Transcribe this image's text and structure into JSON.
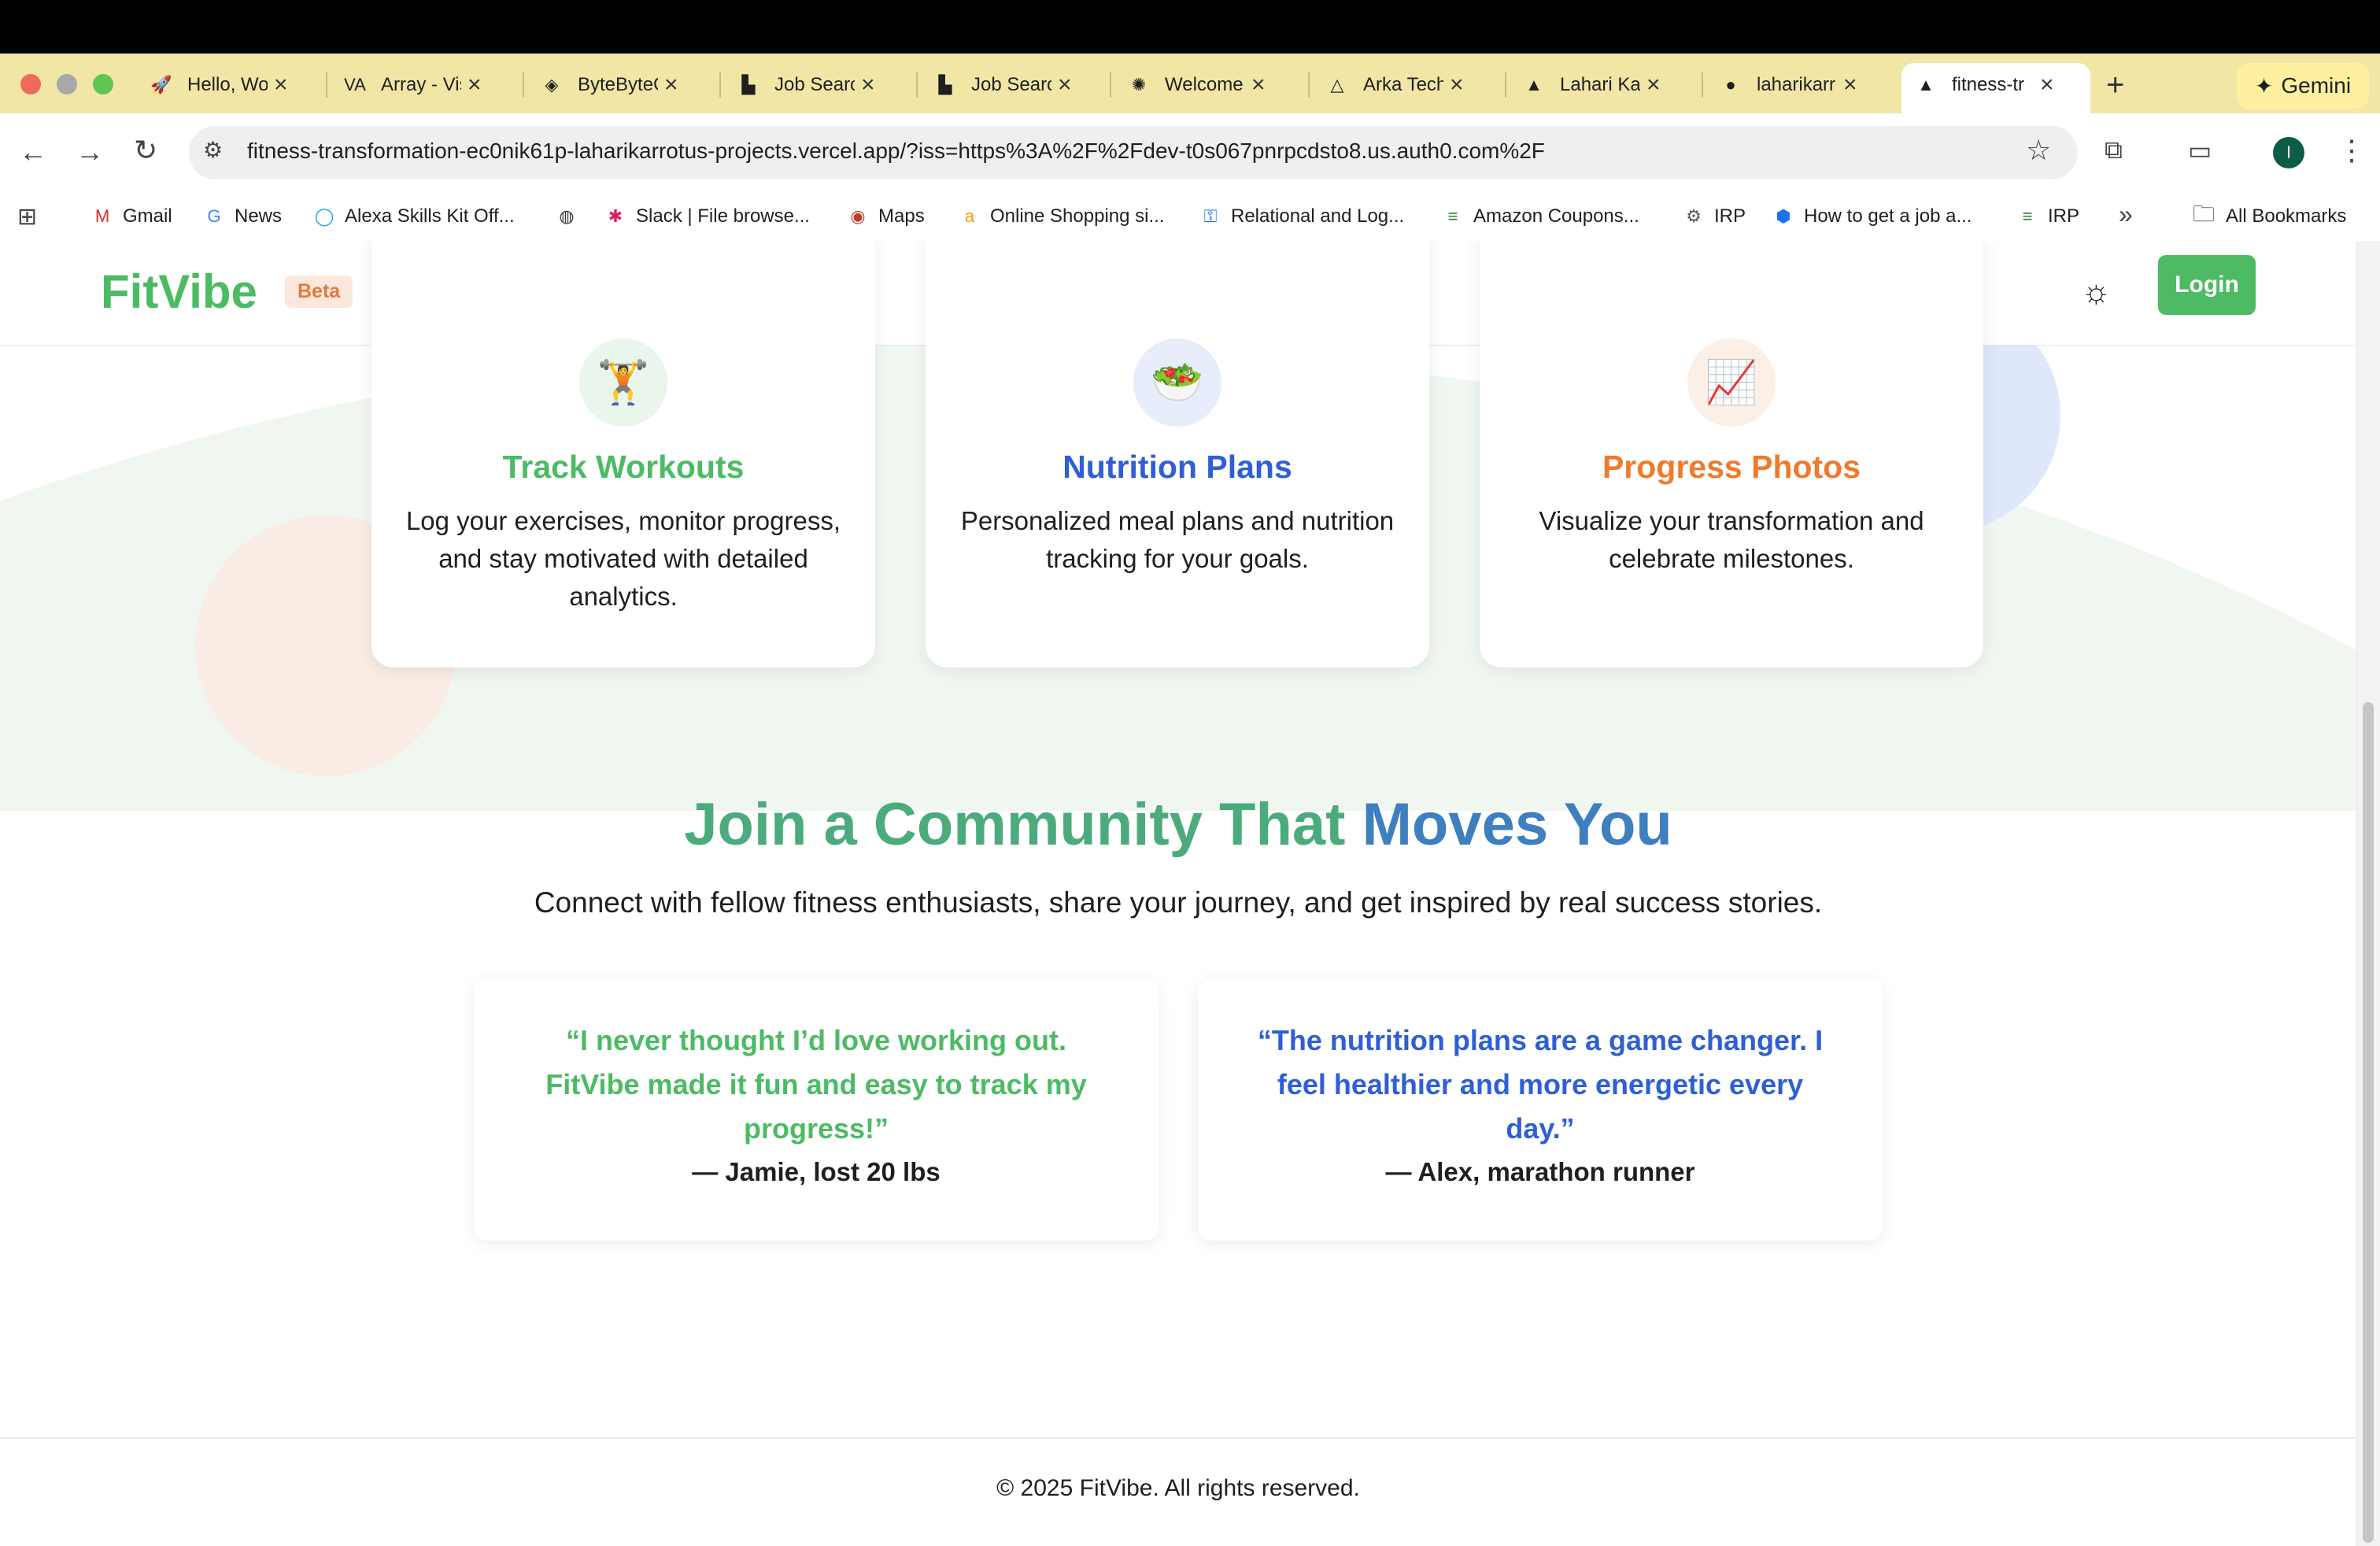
{
  "browser": {
    "tabs": [
      {
        "label": "Hello, World",
        "icon": "rocket-icon",
        "glyph": "🚀"
      },
      {
        "label": "Array - Visualgo",
        "icon": "visualgo-icon",
        "glyph": "VA"
      },
      {
        "label": "ByteByteGo",
        "icon": "bytebytego-icon",
        "glyph": "◈"
      },
      {
        "label": "Job Search",
        "icon": "job-search-icon",
        "glyph": "▙"
      },
      {
        "label": "Job Search",
        "icon": "job-search-icon",
        "glyph": "▙"
      },
      {
        "label": "Welcome",
        "icon": "welcome-icon",
        "glyph": "✺"
      },
      {
        "label": "Arka Tech",
        "icon": "arka-icon",
        "glyph": "△"
      },
      {
        "label": "Lahari Ka",
        "icon": "vercel-icon",
        "glyph": "▲"
      },
      {
        "label": "laharikarr",
        "icon": "github-icon",
        "glyph": "●"
      },
      {
        "label": "fitness-tr",
        "icon": "vercel-icon",
        "glyph": "▲"
      }
    ],
    "new_tab": "+",
    "gemini_label": "Gemini",
    "url": "fitness-transformation-ec0nik61p-laharikarrotus-projects.vercel.app/?iss=https%3A%2F%2Fdev-t0s067pnrpcdsto8.us.auth0.com%2F",
    "bookmarks": [
      {
        "label": "Gmail",
        "glyph": "M",
        "color": "#d93025"
      },
      {
        "label": "News",
        "glyph": "G",
        "color": "#4285f4"
      },
      {
        "label": "Alexa Skills Kit Off...",
        "glyph": "◯",
        "color": "#1aa3e8"
      },
      {
        "label": "",
        "glyph": "◍",
        "color": "#333333"
      },
      {
        "label": "Slack | File browse...",
        "glyph": "✱",
        "color": "#e01e5a"
      },
      {
        "label": "Maps",
        "glyph": "◉",
        "color": "#c0392b"
      },
      {
        "label": "Online Shopping si...",
        "glyph": "a",
        "color": "#ff9900"
      },
      {
        "label": "Relational and Log...",
        "glyph": "⚿",
        "color": "#1a73e8"
      },
      {
        "label": "Amazon Coupons...",
        "glyph": "≡",
        "color": "#2e7d32"
      },
      {
        "label": "IRP",
        "glyph": "⚙",
        "color": "#555555"
      },
      {
        "label": "How to get a job a...",
        "glyph": "⬢",
        "color": "#1a73e8"
      },
      {
        "label": "IRP",
        "glyph": "≡",
        "color": "#2e7d32"
      }
    ],
    "more_bookmarks": "»",
    "all_bookmarks": "All Bookmarks"
  },
  "site": {
    "logo": "FitVibe",
    "badge": "Beta",
    "login": "Login"
  },
  "features": [
    {
      "icon": "weightlifter-icon",
      "glyph": "🏋",
      "title": "Track Workouts",
      "desc": "Log your exercises, monitor progress, and stay motivated with detailed analytics.",
      "color": "#4cbb64",
      "iconbg": "#eaf6ec"
    },
    {
      "icon": "salad-icon",
      "glyph": "🥗",
      "title": "Nutrition Plans",
      "desc": "Personalized meal plans and nutrition tracking for your goals.",
      "color": "#2f5fd6",
      "iconbg": "#e8edfb"
    },
    {
      "icon": "chart-up-icon",
      "glyph": "📈",
      "title": "Progress Photos",
      "desc": "Visualize your transformation and celebrate milestones.",
      "color": "#ef7a2d",
      "iconbg": "#fcefe6"
    }
  ],
  "community": {
    "heading_part1": "Join a Community That",
    "heading_part2": "Moves You",
    "subtitle": "Connect with fellow fitness enthusiasts, share your journey, and get inspired by real success stories."
  },
  "testimonials": [
    {
      "quote": "“I never thought I’d love working out. FitVibe made it fun and easy to track my progress!”",
      "author": "— Jamie, lost 20 lbs",
      "color": "#4cbb64"
    },
    {
      "quote": "“The nutrition plans are a game changer. I feel healthier and more energetic every day.”",
      "author": "— Alex, marathon runner",
      "color": "#2f5fd6"
    }
  ],
  "footer": "© 2025 FitVibe. All rights reserved."
}
